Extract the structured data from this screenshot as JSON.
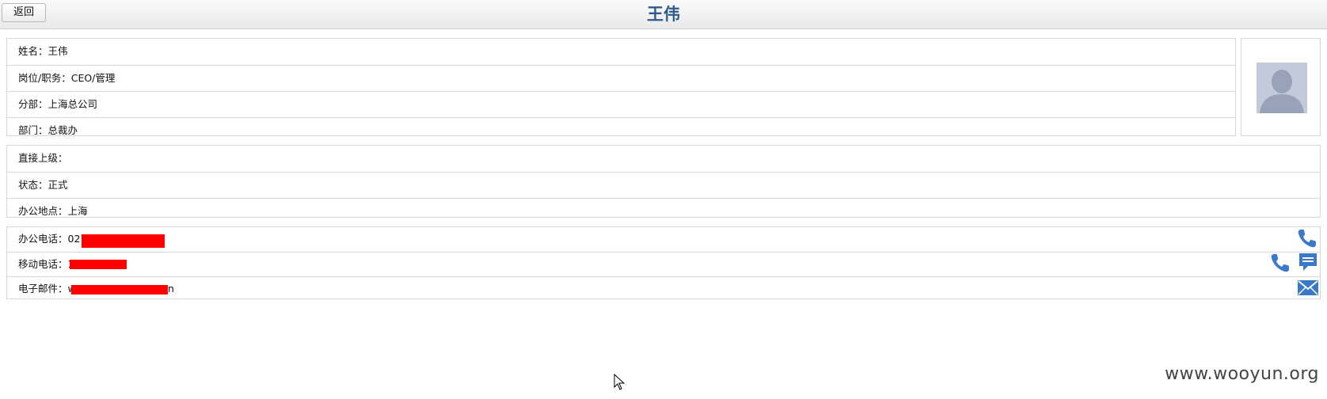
{
  "header": {
    "back_label": "返回",
    "title": "王伟"
  },
  "profile": {
    "name_label": "姓名：",
    "name_value": "王伟",
    "position_label": "岗位/职务：",
    "position_value": "CEO/管理",
    "branch_label": "分部：",
    "branch_value": "上海总公司",
    "department_label": "部门：",
    "department_value": "总裁办"
  },
  "org": {
    "manager_label": "直接上级：",
    "manager_value": "",
    "status_label": "状态：",
    "status_value": "正式",
    "location_label": "办公地点：",
    "location_value": "上海"
  },
  "contact": {
    "office_phone_label": "办公电话：",
    "office_phone_value": "021",
    "mobile_label": "移动电话：",
    "mobile_value": "1",
    "email_label": "电子邮件：",
    "email_value": "w",
    "email_tail": "n"
  },
  "icons": {
    "office_call": "phone-icon",
    "mobile_call": "phone-icon",
    "mobile_sms": "message-icon",
    "email_send": "mail-icon",
    "photo": "avatar-silhouette"
  },
  "colors": {
    "title": "#2f5b8a",
    "icon_blue": "#3a79c8",
    "redaction": "#ff0000"
  },
  "watermark": "www.wooyun.org"
}
